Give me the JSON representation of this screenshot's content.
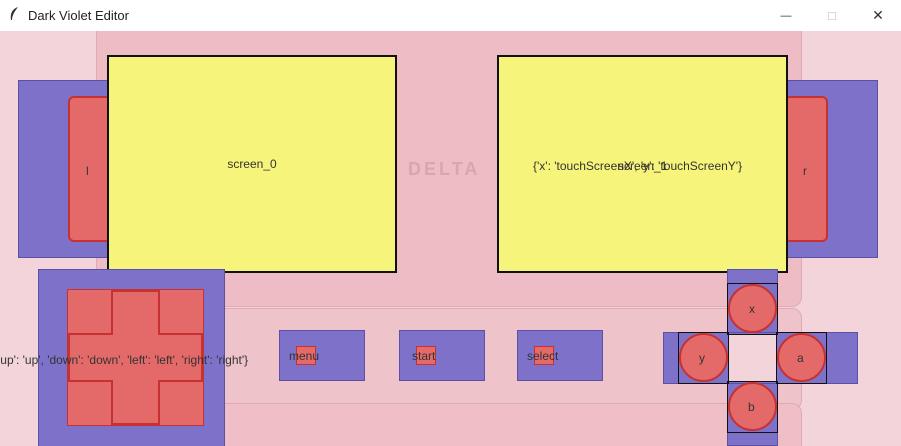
{
  "window": {
    "title": "Dark Violet Editor"
  },
  "titlebar_buttons": {
    "minimize": "—",
    "maximize": "□",
    "close": "✕"
  },
  "skin": {
    "logo": "DELTA"
  },
  "screens": [
    {
      "label": "screen_0"
    },
    {
      "label": "screen_1",
      "mapping": "{'x': 'touchScreenX', 'y': 'touchScreenY'}"
    }
  ],
  "buttons": {
    "l": "l",
    "r": "r",
    "menu": "menu",
    "start": "start",
    "select": "select",
    "x": "x",
    "y": "y",
    "a": "a",
    "b": "b"
  },
  "dpad": {
    "mapping": "{'up': 'up', 'down': 'down', 'left': 'left', 'right': 'right'}"
  },
  "colors": {
    "hitbox": "#7e71c9",
    "button": "#e46a6a",
    "screen": "#f6f47a",
    "skin": "#eebcc4",
    "background": "#f3d4da"
  }
}
